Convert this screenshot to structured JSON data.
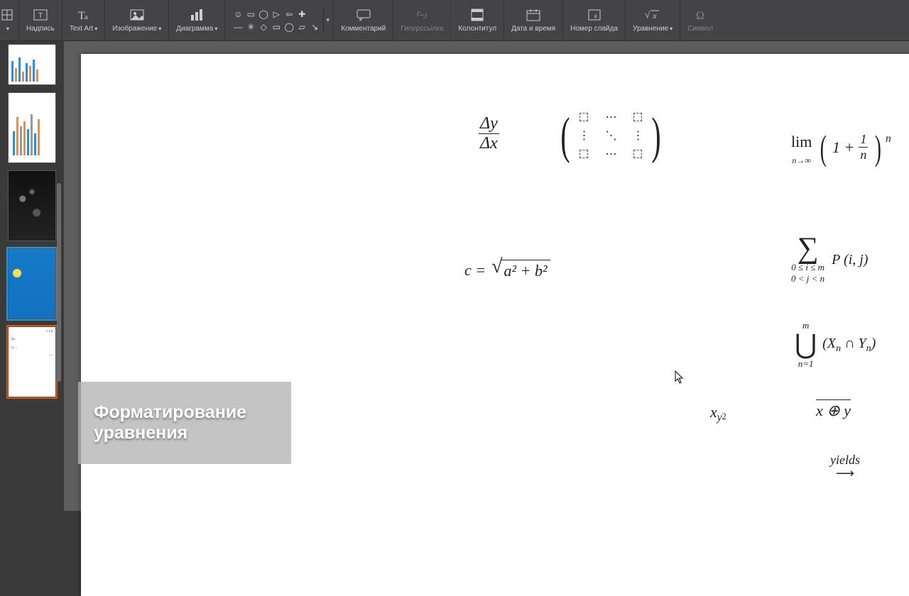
{
  "ribbon": {
    "group0_caret": "▾",
    "label_textbox": "Надпись",
    "label_textart": "Text Art",
    "label_image": "Изображение",
    "label_chart": "Диаграмма",
    "label_comment": "Комментарий",
    "label_hyperlink": "Гиперссылка",
    "label_headerfooter": "Колонтитул",
    "label_datetime": "Дата и время",
    "label_slidenum": "Номер слайда",
    "label_equation": "Уравнение",
    "label_symbol": "Символ",
    "shape_glyphs": [
      "☺",
      "▭",
      "◯",
      "▷",
      "⇦",
      "✚",
      "",
      "—",
      "✳",
      "◇",
      "▭",
      "◯",
      "▱",
      "⇘"
    ]
  },
  "tooltip": {
    "line1": "Форматирование",
    "line2": "уравнения"
  },
  "equations": {
    "frac_num": "Δy",
    "frac_den": "Δx",
    "matrix_dots_h": "⋯",
    "matrix_dots_v": "⋮",
    "matrix_dots_d": "⋱",
    "lim_label": "lim",
    "lim_sub": "n→∞",
    "lim_inside_left": "1 +",
    "lim_frac_num": "1",
    "lim_frac_den": "n",
    "lim_exp": "n",
    "pyth_lhs": "c =",
    "pyth_rhs": "a² + b²",
    "sum_body": "P (i, j)",
    "sum_sub1": "0 ≤ i ≤ m",
    "sum_sub2": "0 < j < n",
    "union_top": "m",
    "union_bot": "n=1",
    "union_body_l": "(X",
    "union_body_mid": " ∩ Y",
    "union_body_r": ")",
    "union_sub1": "n",
    "union_sub2": "n",
    "xy2_main": "x",
    "xy2_sub": "y",
    "xy2_subexp": "2",
    "overline_body": "x ⊕ y",
    "yields_label": "yields",
    "yields_arrow": "⟶"
  }
}
